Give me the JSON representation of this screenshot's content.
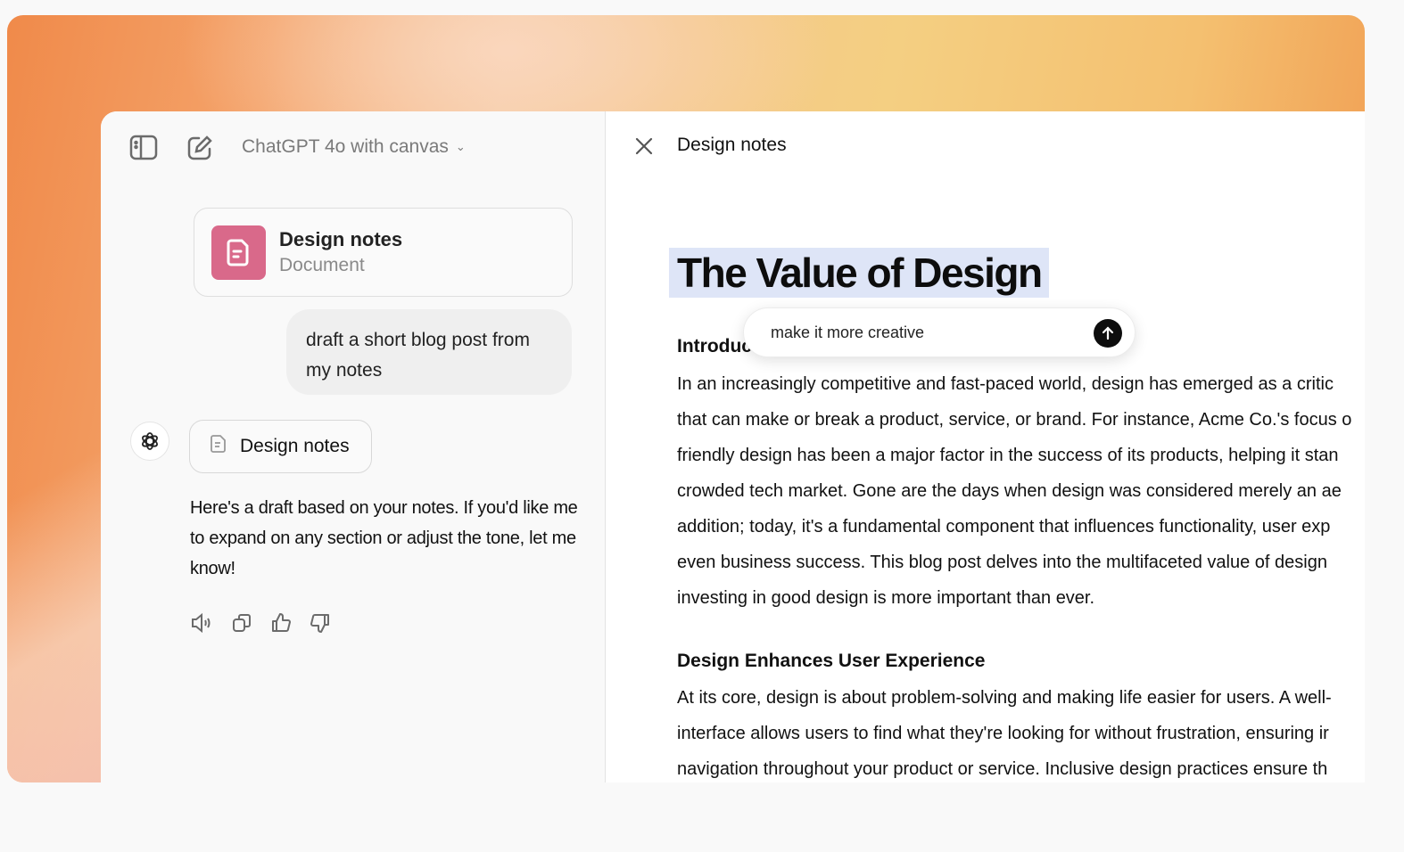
{
  "header": {
    "model_label": "ChatGPT 4o with canvas"
  },
  "chat": {
    "doc_card": {
      "title": "Design notes",
      "subtitle": "Document"
    },
    "user_message": "draft a short blog post from my notes",
    "assistant_chip": "Design notes",
    "assistant_reply": "Here's a draft based on your notes. If you'd like me to expand on any section or adjust the tone, let me know!",
    "actions": [
      "speaker-icon",
      "copy-icon",
      "thumbs-up-icon",
      "thumbs-down-icon"
    ]
  },
  "canvas": {
    "title": "Design notes",
    "doc_title": "The Value of Design",
    "prompt_value": "make it more creative",
    "sections": [
      {
        "heading": "Introduction",
        "lines": [
          "In an increasingly competitive and fast-paced world, design has emerged as a critic",
          "that can make or break a product, service, or brand. For instance, Acme Co.'s focus o",
          "friendly design has been a major factor in the success of its products, helping it stan",
          "crowded tech market. Gone are the days when design was considered merely an ae",
          "addition; today, it's a fundamental component that influences functionality, user exp",
          "even business success. This blog post delves into the multifaceted value of design",
          "investing in good design is more important than ever."
        ]
      },
      {
        "heading": "Design Enhances User Experience",
        "lines": [
          "At its core, design is about problem-solving and making life easier for users. A well-",
          "interface allows users to find what they're looking for without frustration, ensuring ir",
          "navigation throughout your product or service. Inclusive design practices ensure th"
        ]
      }
    ]
  },
  "colors": {
    "doc_icon": "#d9698a",
    "selection": "#dee5f7",
    "send_button": "#0d0d0d"
  }
}
